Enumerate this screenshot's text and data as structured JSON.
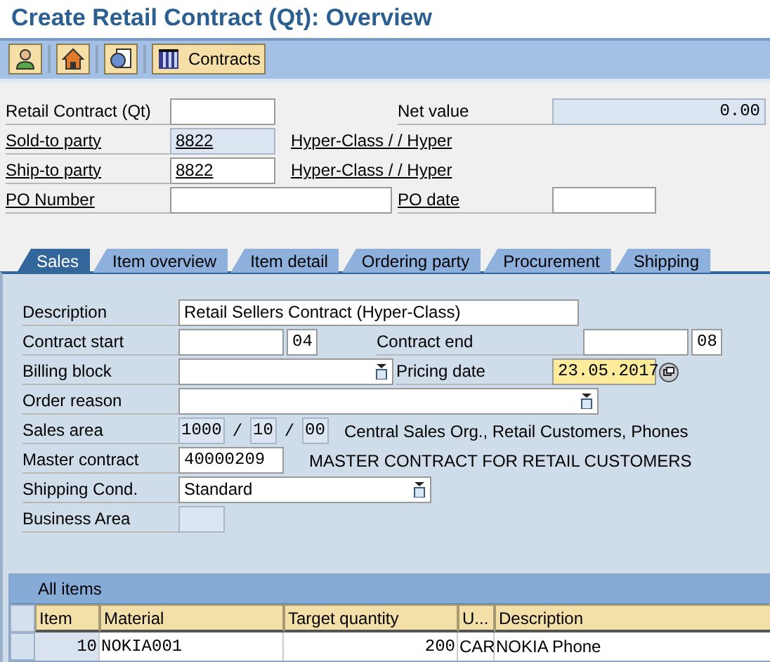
{
  "title": "Create Retail Contract (Qt): Overview",
  "toolbar": {
    "buttons": [
      {
        "kind": "person"
      },
      {
        "kind": "house"
      },
      {
        "kind": "document"
      },
      {
        "kind": "grid",
        "label": "Contracts"
      }
    ]
  },
  "header": {
    "rows": [
      {
        "label": "Retail Contract (Qt)",
        "link": false,
        "value": "",
        "readonly": false,
        "right_label": "Net value",
        "right_value": "0.00"
      },
      {
        "label": "Sold-to party",
        "link": true,
        "value": "8822",
        "readonly": true,
        "name": "Hyper-Class / / Hyper"
      },
      {
        "label": "Ship-to party",
        "link": true,
        "value": "8822",
        "readonly": false,
        "name": "Hyper-Class / / Hyper"
      },
      {
        "label": "PO Number",
        "link": true,
        "value": "",
        "readonly": false,
        "wide": true,
        "right_label": "PO date",
        "right_link": true
      }
    ]
  },
  "tabs": [
    {
      "label": "Sales",
      "selected": true
    },
    {
      "label": "Item overview",
      "selected": false
    },
    {
      "label": "Item detail",
      "selected": false
    },
    {
      "label": "Ordering party",
      "selected": false
    },
    {
      "label": "Procurement",
      "selected": false
    },
    {
      "label": "Shipping",
      "selected": false
    }
  ],
  "sales": {
    "description": {
      "label": "Description",
      "value": "Retail Sellers Contract (Hyper-Class)"
    },
    "contract_start": {
      "label": "Contract start",
      "unit": "04"
    },
    "contract_end": {
      "label": "Contract end",
      "unit": "08"
    },
    "billing_block": {
      "label": "Billing block"
    },
    "pricing_date": {
      "label": "Pricing date",
      "value": "23.05.2017"
    },
    "order_reason": {
      "label": "Order reason"
    },
    "sales_area": {
      "label": "Sales area",
      "parts": [
        "1000",
        "10",
        "00"
      ],
      "separator": "/",
      "text": "Central Sales Org., Retail Customers, Phones"
    },
    "master_contract": {
      "label": "Master contract",
      "value": "40000209",
      "text": "MASTER CONTRACT FOR RETAIL CUSTOMERS"
    },
    "shipping_cond": {
      "label": "Shipping Cond.",
      "value": "Standard"
    },
    "business_area": {
      "label": "Business Area"
    }
  },
  "table": {
    "title": "All items",
    "columns": [
      "Item",
      "Material",
      "Target quantity",
      "U...",
      "Description"
    ],
    "rows": [
      {
        "cells": [
          "10",
          "NOKIA001",
          "200",
          "CAR",
          "NOKIA Phone"
        ]
      }
    ]
  }
}
